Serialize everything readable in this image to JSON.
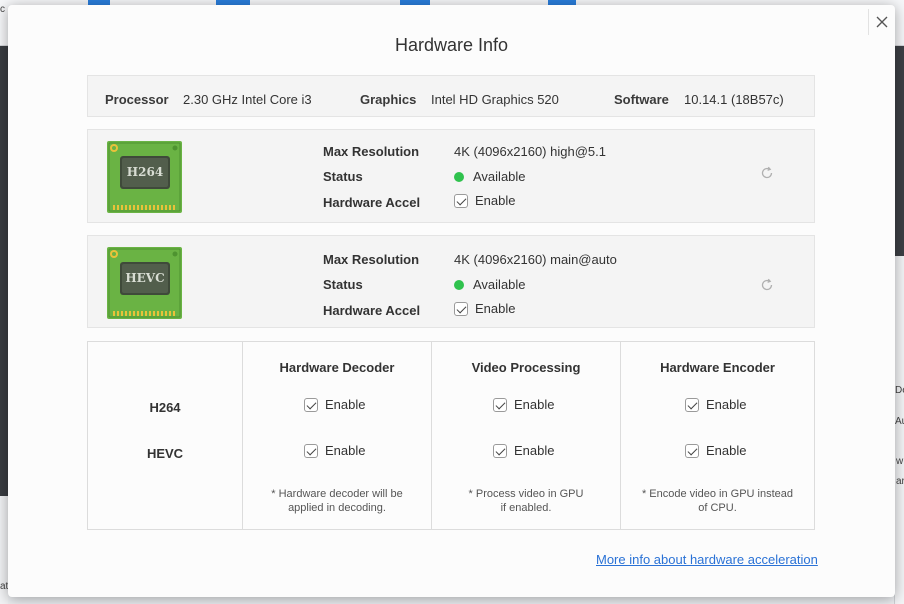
{
  "dialog": {
    "title": "Hardware Info",
    "more_link": "More info about hardware acceleration"
  },
  "system": {
    "processor_label": "Processor",
    "processor_value": "2.30 GHz Intel Core i3",
    "graphics_label": "Graphics",
    "graphics_value": "Intel HD Graphics 520",
    "software_label": "Software",
    "software_value": "10.14.1 (18B57c)"
  },
  "codecs": [
    {
      "name": "H264",
      "max_resolution_label": "Max Resolution",
      "max_resolution_value": "4K (4096x2160) high@5.1",
      "status_label": "Status",
      "status_value": "Available",
      "accel_label": "Hardware Accel",
      "accel_value": "Enable"
    },
    {
      "name": "HEVC",
      "max_resolution_label": "Max Resolution",
      "max_resolution_value": "4K (4096x2160) main@auto",
      "status_label": "Status",
      "status_value": "Available",
      "accel_label": "Hardware Accel",
      "accel_value": "Enable"
    }
  ],
  "table": {
    "columns": [
      "Hardware Decoder",
      "Video Processing",
      "Hardware Encoder"
    ],
    "rows": [
      "H264",
      "HEVC"
    ],
    "cell_label": "Enable",
    "notes": [
      [
        "* Hardware decoder will be",
        "applied in decoding."
      ],
      [
        "* Process video in GPU",
        "if enabled."
      ],
      [
        "* Encode video in GPU instead",
        "of CPU."
      ]
    ]
  },
  "background": {
    "fragments": [
      "c",
      "De",
      "Au",
      "w",
      "ar",
      "at"
    ]
  },
  "colors": {
    "status_available": "#2fc24d",
    "link": "#2a72d6",
    "chip_green": "#6ab344"
  },
  "icons": [
    "close-icon",
    "chip-icon",
    "refresh-icon",
    "checkbox-icon"
  ]
}
